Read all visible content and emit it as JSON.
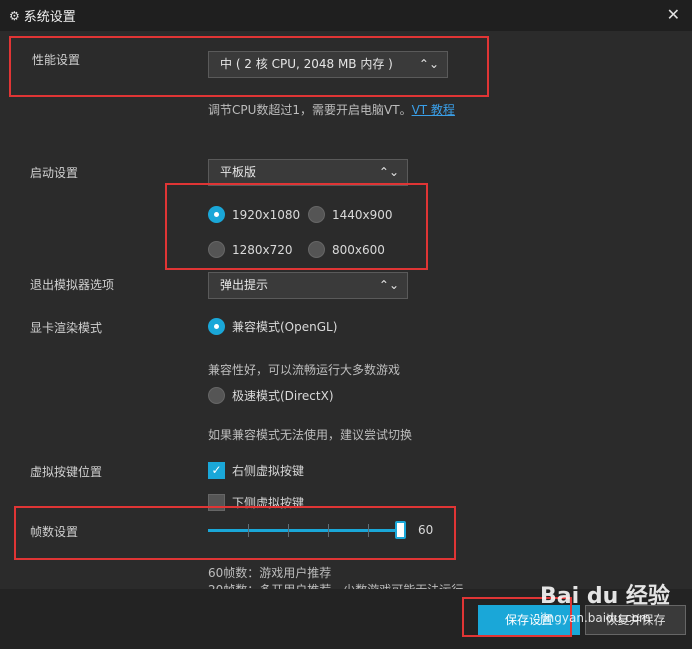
{
  "window": {
    "title": "系统设置",
    "close_glyph": "✕"
  },
  "performance": {
    "label": "性能设置",
    "selected": "中 ( 2 核 CPU, 2048 MB 内存 )",
    "hint_prefix": "调节CPU数超过1，需要开启电脑VT。",
    "hint_link": "VT 教程"
  },
  "startup": {
    "label": "启动设置",
    "selected": "平板版",
    "resolutions": [
      {
        "label": "1920x1080",
        "checked": true
      },
      {
        "label": "1440x900",
        "checked": false
      },
      {
        "label": "1280x720",
        "checked": false
      },
      {
        "label": "800x600",
        "checked": false
      }
    ]
  },
  "exit": {
    "label": "退出模拟器选项",
    "selected": "弹出提示"
  },
  "render": {
    "label": "显卡渲染模式",
    "options": [
      {
        "label": "兼容模式(OpenGL)",
        "checked": true,
        "note": "兼容性好，可以流畅运行大多数游戏"
      },
      {
        "label": "极速模式(DirectX)",
        "checked": false,
        "note": "如果兼容模式无法使用，建议尝试切换"
      }
    ]
  },
  "virtual_keys": {
    "label": "虚拟按键位置",
    "options": [
      {
        "label": "右侧虚拟按键",
        "checked": true
      },
      {
        "label": "下侧虚拟按键",
        "checked": false
      }
    ]
  },
  "fps": {
    "label": "帧数设置",
    "value": 60,
    "value_text": "60",
    "min": 0,
    "max": 60,
    "notes": [
      "60帧数：游戏用户推荐",
      "20帧数：多开用户推荐，少数游戏可能无法运行"
    ]
  },
  "footer": {
    "save_label": "保存设置",
    "reset_label": "恢复并保存"
  },
  "watermark": {
    "main": "Bai du 经验",
    "sub": "jingyan.baidu.com"
  },
  "colors": {
    "accent": "#1aa7d8",
    "highlight_box": "#e03535",
    "link": "#3a9fe8"
  }
}
